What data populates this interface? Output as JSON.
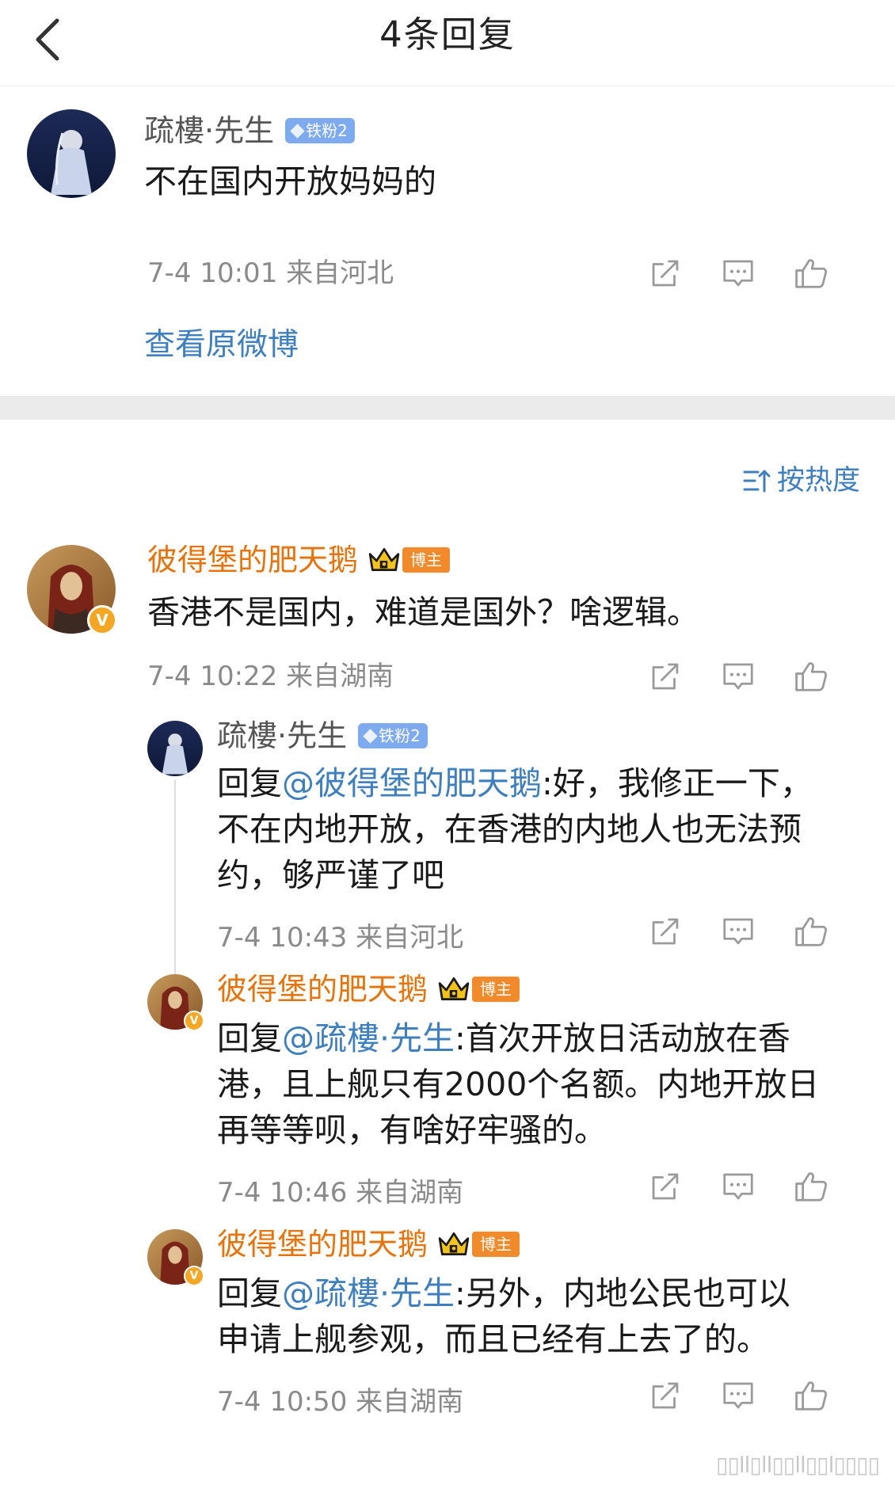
{
  "header": {
    "title": "4条回复"
  },
  "main_comment": {
    "user": "疏樓·先生",
    "badge": "铁粉2",
    "text": "不在国内开放妈妈的",
    "meta": "7-4 10:01  来自河北",
    "view_original": "查看原微博"
  },
  "sort_label": "按热度",
  "comment": {
    "user": "彼得堡的肥天鹅",
    "badge": "博主",
    "text": "香港不是国内，难道是国外？啥逻辑。",
    "meta": "7-4 10:22  来自湖南"
  },
  "replies": [
    {
      "user": "疏樓·先生",
      "badge": "铁粉2",
      "prefix": "回复",
      "mention": "@彼得堡的肥天鹅",
      "line1_rest": ":好，我修正一下，",
      "line2": "不在内地开放，在香港的内地人也无法预",
      "line3": "约，够严谨了吧",
      "meta": "7-4 10:43  来自河北"
    },
    {
      "user": "彼得堡的肥天鹅",
      "badge": "博主",
      "prefix": "回复",
      "mention": "@疏樓·先生",
      "line1_rest": ":首次开放日活动放在香",
      "line2": "港，且上舰只有2000个名额。内地开放日",
      "line3": "再等等呗，有啥好牢骚的。",
      "meta": "7-4 10:46  来自湖南"
    },
    {
      "user": "彼得堡的肥天鹅",
      "badge": "博主",
      "prefix": "回复",
      "mention": "@疏樓·先生",
      "line1_rest": ":另外，内地公民也可以",
      "line2": "申请上舰参观，而且已经有上去了的。",
      "meta": "7-4 10:50  来自湖南"
    }
  ],
  "watermark": "▯▯ll▯ll▯▯ll▯▯l▯▯▯▯"
}
